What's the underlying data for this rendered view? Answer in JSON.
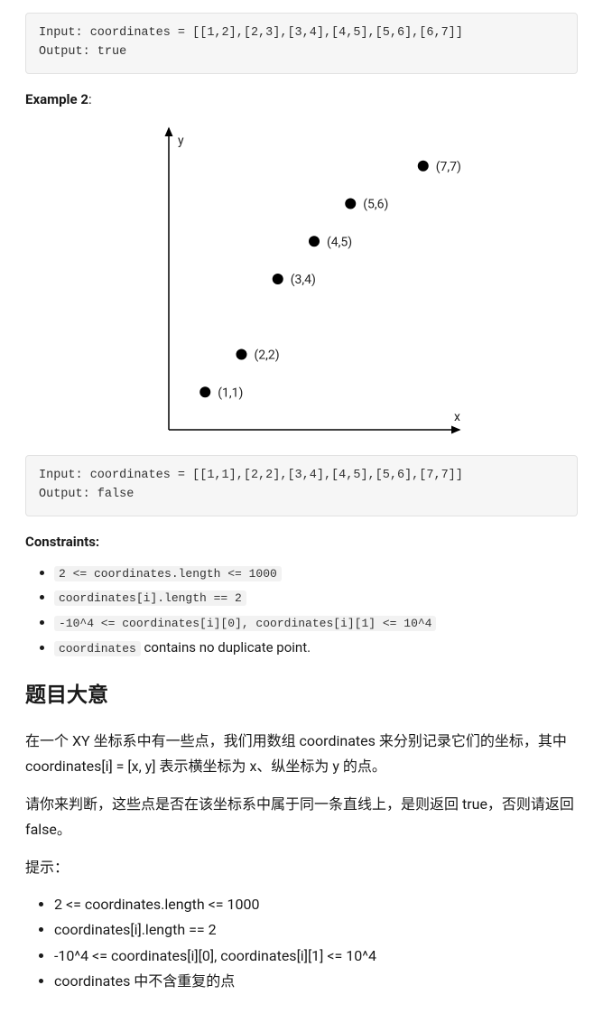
{
  "example1": {
    "input_line": "Input: coordinates = [[1,2],[2,3],[3,4],[4,5],[5,6],[6,7]]",
    "output_line": "Output: true"
  },
  "example2_label": "Example 2",
  "chart_data": {
    "type": "scatter",
    "title": "",
    "xlabel": "x",
    "ylabel": "y",
    "xlim": [
      0,
      8
    ],
    "ylim": [
      0,
      8
    ],
    "points": [
      {
        "x": 1,
        "y": 1,
        "label": "(1,1)"
      },
      {
        "x": 2,
        "y": 2,
        "label": "(2,2)"
      },
      {
        "x": 3,
        "y": 4,
        "label": "(3,4)"
      },
      {
        "x": 4,
        "y": 5,
        "label": "(4,5)"
      },
      {
        "x": 5,
        "y": 6,
        "label": "(5,6)"
      },
      {
        "x": 7,
        "y": 7,
        "label": "(7,7)"
      }
    ]
  },
  "example2": {
    "input_line": "Input: coordinates = [[1,1],[2,2],[3,4],[4,5],[5,6],[7,7]]",
    "output_line": "Output: false"
  },
  "constraints_label": "Constraints:",
  "constraints": [
    {
      "code": "2 <= coordinates.length <= 1000"
    },
    {
      "code": "coordinates[i].length == 2"
    },
    {
      "code": "-10^4 <= coordinates[i][0], coordinates[i][1] <= 10^4"
    },
    {
      "code": "coordinates",
      "suffix": " contains no duplicate point."
    }
  ],
  "section_title": "题目大意",
  "para1": "在一个 XY 坐标系中有一些点，我们用数组 coordinates 来分别记录它们的坐标，其中 coordinates[i] = [x, y] 表示横坐标为 x、纵坐标为 y 的点。",
  "para2": "请你来判断，这些点是否在该坐标系中属于同一条直线上，是则返回 true，否则请返回 false。",
  "hints_label": "提示：",
  "hints": [
    "2 <= coordinates.length <= 1000",
    "coordinates[i].length == 2",
    "-10^4 <= coordinates[i][0], coordinates[i][1] <= 10^4",
    "coordinates 中不含重复的点"
  ]
}
